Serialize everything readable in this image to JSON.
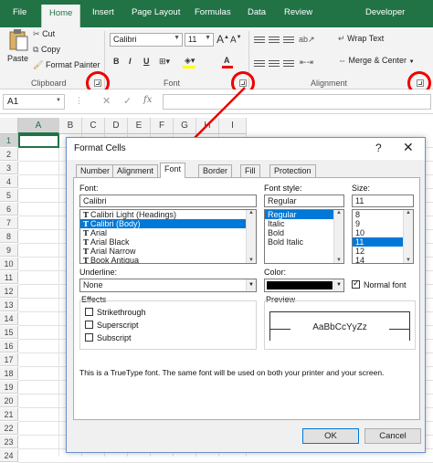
{
  "ribbon_tabs": [
    "File",
    "Home",
    "Insert",
    "Page Layout",
    "Formulas",
    "Data",
    "Review",
    "Developer"
  ],
  "clipboard": {
    "paste": "Paste",
    "cut": "Cut",
    "copy": "Copy",
    "format_painter": "Format Painter",
    "group_label": "Clipboard"
  },
  "font_group": {
    "font_name": "Calibri",
    "font_size": "11",
    "bold": "B",
    "italic": "I",
    "underline": "U",
    "font_color_glyph": "A",
    "group_label": "Font"
  },
  "alignment_group": {
    "wrap_text": "Wrap Text",
    "merge_center": "Merge & Center",
    "group_label": "Alignment"
  },
  "formula_bar": {
    "name_box": "A1",
    "cancel": "✕",
    "enter": "✓",
    "fx": "fx"
  },
  "grid": {
    "columns": [
      "A",
      "B",
      "C",
      "D",
      "E",
      "F",
      "G",
      "H",
      "I"
    ],
    "rows": [
      "1",
      "2",
      "3",
      "4",
      "5",
      "6",
      "7",
      "8",
      "9",
      "10",
      "11",
      "12",
      "13",
      "14",
      "15",
      "16",
      "17",
      "18",
      "19",
      "20",
      "21",
      "22",
      "23",
      "24"
    ]
  },
  "dialog": {
    "title": "Format Cells",
    "help": "?",
    "close": "✕",
    "tabs": [
      "Number",
      "Alignment",
      "Font",
      "Border",
      "Fill",
      "Protection"
    ],
    "active_tab": "Font",
    "font_label": "Font:",
    "font_value": "Calibri",
    "font_list": [
      "Calibri Light (Headings)",
      "Calibri (Body)",
      "Arial",
      "Arial Black",
      "Arial Narrow",
      "Book Antiqua"
    ],
    "font_selected_index": 1,
    "tt_glyph": "T",
    "style_label": "Font style:",
    "style_value": "Regular",
    "style_list": [
      "Regular",
      "Italic",
      "Bold",
      "Bold Italic"
    ],
    "style_selected_index": 0,
    "size_label": "Size:",
    "size_value": "11",
    "size_list": [
      "8",
      "9",
      "10",
      "11",
      "12",
      "14"
    ],
    "size_selected_index": 3,
    "underline_label": "Underline:",
    "underline_value": "None",
    "color_label": "Color:",
    "color_swatch": "#000000",
    "normal_font": "Normal font",
    "normal_font_checked": true,
    "effects_label": "Effects",
    "strikethrough": "Strikethrough",
    "superscript": "Superscript",
    "subscript": "Subscript",
    "preview_label": "Preview",
    "preview_text": "AaBbCcYyZz",
    "info_text": "This is a TrueType font.  The same font will be used on both your printer and your screen.",
    "ok": "OK",
    "cancel": "Cancel"
  },
  "colors": {
    "excel_green": "#217346",
    "annotation_red": "#e00000",
    "selection_blue": "#0078d7"
  }
}
